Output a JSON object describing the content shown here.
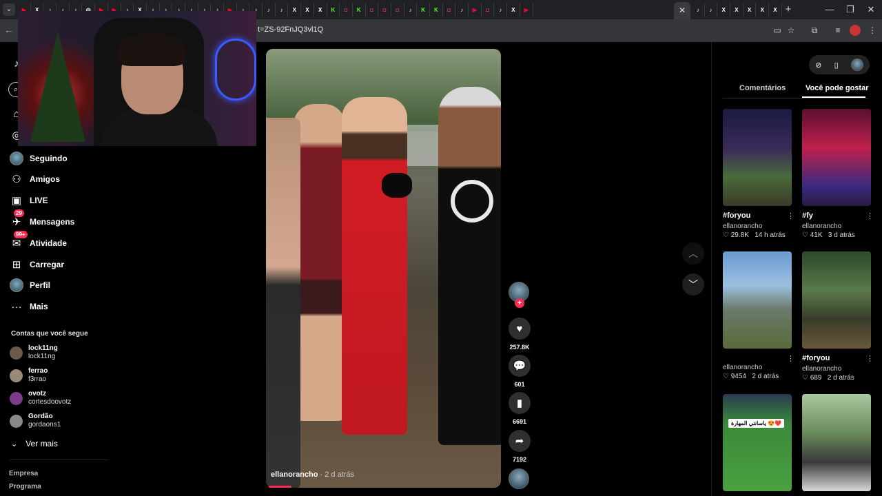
{
  "browser": {
    "url_fragment": "t=ZS-92FnJQ3vl1Q",
    "tab_favicons": [
      {
        "glyph": "▶",
        "color": "#ff0033"
      },
      {
        "glyph": "X",
        "color": "#ffffff"
      },
      {
        "glyph": "♪",
        "color": "#ffffff"
      },
      {
        "glyph": "♪",
        "color": "#ffffff"
      },
      {
        "glyph": "♪",
        "color": "#ffffff"
      },
      {
        "glyph": "◎",
        "color": "#ffffff"
      },
      {
        "glyph": "▶",
        "color": "#ff0033"
      },
      {
        "glyph": "▶",
        "color": "#ff0033"
      },
      {
        "glyph": "♪",
        "color": "#ffffff"
      },
      {
        "glyph": "X",
        "color": "#ffffff"
      },
      {
        "glyph": "♪",
        "color": "#ffffff"
      },
      {
        "glyph": "♪",
        "color": "#ffffff"
      },
      {
        "glyph": "♪",
        "color": "#ffffff"
      },
      {
        "glyph": "♪",
        "color": "#ffffff"
      },
      {
        "glyph": "♪",
        "color": "#ffffff"
      },
      {
        "glyph": "♪",
        "color": "#ffffff"
      },
      {
        "glyph": "▶",
        "color": "#ff0033"
      },
      {
        "glyph": "♪",
        "color": "#ffffff"
      },
      {
        "glyph": "♪",
        "color": "#ffffff"
      },
      {
        "glyph": "♪",
        "color": "#ffffff"
      },
      {
        "glyph": "♪",
        "color": "#ffffff"
      },
      {
        "glyph": "X",
        "color": "#ffffff"
      },
      {
        "glyph": "X",
        "color": "#ffffff"
      },
      {
        "glyph": "X",
        "color": "#ffffff"
      },
      {
        "glyph": "K",
        "color": "#53fc18"
      },
      {
        "glyph": "◘",
        "color": "#e1306c"
      },
      {
        "glyph": "K",
        "color": "#53fc18"
      },
      {
        "glyph": "◘",
        "color": "#e1306c"
      },
      {
        "glyph": "◘",
        "color": "#e1306c"
      },
      {
        "glyph": "◘",
        "color": "#e1306c"
      },
      {
        "glyph": "♪",
        "color": "#ffffff"
      },
      {
        "glyph": "K",
        "color": "#53fc18"
      },
      {
        "glyph": "K",
        "color": "#53fc18"
      },
      {
        "glyph": "◘",
        "color": "#e1306c"
      },
      {
        "glyph": "♪",
        "color": "#ffffff"
      },
      {
        "glyph": "▶",
        "color": "#ff0033"
      },
      {
        "glyph": "◘",
        "color": "#e1306c"
      },
      {
        "glyph": "♪",
        "color": "#ffffff"
      },
      {
        "glyph": "X",
        "color": "#ffffff"
      },
      {
        "glyph": "▶",
        "color": "#ff0033"
      }
    ],
    "after_active_favicons": [
      {
        "glyph": "♪",
        "color": "#ffffff"
      },
      {
        "glyph": "♪",
        "color": "#ffffff"
      },
      {
        "glyph": "X",
        "color": "#ffffff"
      },
      {
        "glyph": "X",
        "color": "#ffffff"
      },
      {
        "glyph": "X",
        "color": "#ffffff"
      },
      {
        "glyph": "X",
        "color": "#ffffff"
      },
      {
        "glyph": "X",
        "color": "#ffffff"
      }
    ]
  },
  "sidebar": {
    "nav": [
      {
        "key": "seguindo",
        "label": "Seguindo",
        "icon": "avatar"
      },
      {
        "key": "amigos",
        "label": "Amigos",
        "icon": "friends-icon",
        "glyph": "⚇"
      },
      {
        "key": "live",
        "label": "LIVE",
        "icon": "live-icon",
        "glyph": "▣"
      },
      {
        "key": "mensagens",
        "label": "Mensagens",
        "icon": "messages-icon",
        "glyph": "✈",
        "badge": "29"
      },
      {
        "key": "atividade",
        "label": "Atividade",
        "icon": "activity-icon",
        "glyph": "✉",
        "badge": "99+"
      },
      {
        "key": "carregar",
        "label": "Carregar",
        "icon": "upload-icon",
        "glyph": "⊞"
      },
      {
        "key": "perfil",
        "label": "Perfil",
        "icon": "avatar"
      },
      {
        "key": "mais",
        "label": "Mais",
        "icon": "more-icon",
        "glyph": "···"
      }
    ],
    "following_title": "Contas que você segue",
    "following": [
      {
        "name": "lock11ng",
        "handle": "lock11ng",
        "avatar_color": "#6b5a4a"
      },
      {
        "name": "ferrao",
        "handle": "f3rrao",
        "avatar_color": "#9a8a7a"
      },
      {
        "name": "ovotz",
        "handle": "cortesdoovotz",
        "avatar_color": "#7a3c8c"
      },
      {
        "name": "Gordão",
        "handle": "gordaons1",
        "avatar_color": "#8a8a8a"
      }
    ],
    "see_more": "Ver mais",
    "footer": [
      "Empresa",
      "Programa"
    ]
  },
  "video": {
    "username": "ellanorancho",
    "age": " · 2 d atrás",
    "likes": "257.8K",
    "comments": "601",
    "saves": "6691",
    "shares": "7192"
  },
  "right_panel": {
    "tabs": [
      "Comentários",
      "Você pode gostar"
    ],
    "active_tab": "Você pode gostar",
    "items": [
      {
        "title": "#foryou",
        "user": "ellanorancho",
        "likes": "29.8K",
        "age": "14 h atrás",
        "bg": "linear-gradient(180deg,#1a1a40 0%,#3a2a5a 40%,#4a6a3a 70%,#3a3a2a 100%)"
      },
      {
        "title": "#fy",
        "user": "ellanorancho",
        "likes": "41K",
        "age": "3 d atrás",
        "bg": "linear-gradient(180deg,#5a1030 0%,#c0204a 40%,#3a2a80 80%,#2a1a40 100%)"
      },
      {
        "title": "",
        "user": "ellanorancho",
        "likes": "9454",
        "age": "2 d atrás",
        "bg": "linear-gradient(180deg,#6a9ad0 0%,#9ac0e0 35%,#6a7a6a 60%,#5a6a3a 100%)"
      },
      {
        "title": "#foryou",
        "user": "ellanorancho",
        "likes": "689",
        "age": "2 d atrás",
        "bg": "linear-gradient(180deg,#2a4a2a 0%,#5a7a4a 40%,#3a3a2a 70%,#6a5a3a 100%)"
      },
      {
        "title": "",
        "user": "",
        "likes": "",
        "age": "",
        "bg": "linear-gradient(180deg,#2a3a50 0%,#3a8a3a 30%,#4aa040 100%)",
        "caption": "ياسانتي المهارة 😍❤️"
      },
      {
        "title": "",
        "user": "",
        "likes": "",
        "age": "",
        "bg": "linear-gradient(180deg,#a8c8a0 0%,#6a8a5a 40%,#3a3a3a 70%,#d8d8d8 100%)"
      }
    ]
  }
}
